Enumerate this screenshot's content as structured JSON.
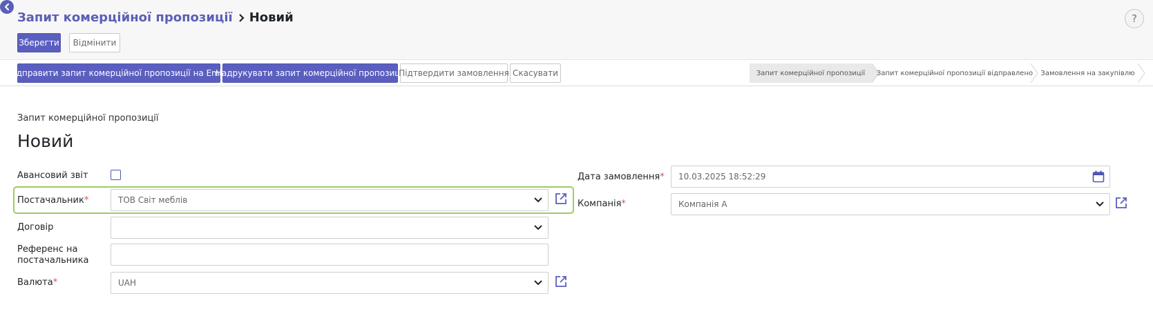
{
  "header": {
    "breadcrumb_parent": "Запит комерційної пропозиції",
    "breadcrumb_current": "Новий",
    "help_label": "?"
  },
  "actions": {
    "save": "Зберегти",
    "discard": "Відмінити"
  },
  "workflow": {
    "send_email": "Відправити запит комерційної пропозиції на Email",
    "print": "Надрукувати запит комерційної пропозиції",
    "confirm": "Підтвердити замовлення",
    "cancel": "Скасувати"
  },
  "stages": [
    {
      "label": "Запит комерційної пропозиції",
      "active": true
    },
    {
      "label": "Запит комерційної пропозиції відправлено",
      "active": false
    },
    {
      "label": "Замовлення на закупівлю",
      "active": false
    }
  ],
  "form": {
    "subtitle": "Запит комерційної пропозиції",
    "title": "Новий",
    "advance_report": {
      "label": "Авансовий звіт",
      "checked": false
    },
    "vendor": {
      "label": "Постачальник",
      "required_mark": "*",
      "value": "ТОВ Світ меблів"
    },
    "contract": {
      "label": "Договір",
      "value": ""
    },
    "vendor_reference": {
      "label_line1": "Референс на",
      "label_line2": "постачальника",
      "value": ""
    },
    "currency": {
      "label": "Валюта",
      "required_mark": "*",
      "value": "UAH"
    },
    "order_date": {
      "label": "Дата замовлення",
      "required_mark": "*",
      "value": "10.03.2025 18:52:29"
    },
    "company": {
      "label": "Компанія",
      "required_mark": "*",
      "value": "Компанія А"
    }
  },
  "colors": {
    "primary": "#5a5fbf",
    "link": "#5c5fb4",
    "highlight": "#9ccc65",
    "required": "#d9534f"
  }
}
